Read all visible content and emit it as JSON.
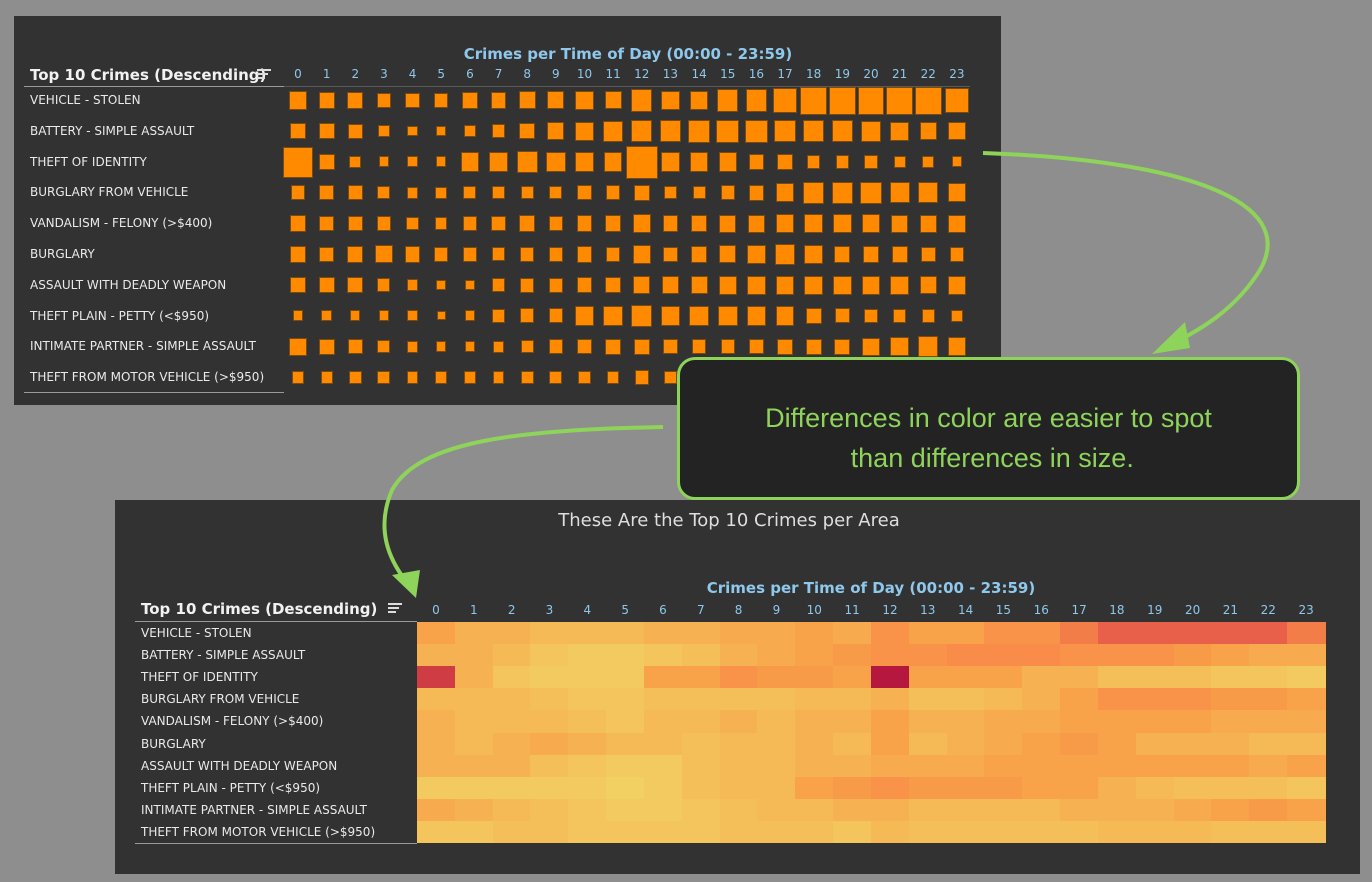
{
  "callout": {
    "line1": "Differences in color are easier to spot",
    "line2": " than differences in size."
  },
  "chart_data": [
    {
      "type": "scatter",
      "mark": "square-size",
      "title": "Crimes per Time of Day (00:00 - 23:59)",
      "row_header": "Top 10 Crimes (Descending)",
      "color": "#ff8a00",
      "hours": [
        "0",
        "1",
        "2",
        "3",
        "4",
        "5",
        "6",
        "7",
        "8",
        "9",
        "10",
        "11",
        "12",
        "13",
        "14",
        "15",
        "16",
        "17",
        "18",
        "19",
        "20",
        "21",
        "22",
        "23"
      ],
      "crimes": [
        "VEHICLE - STOLEN",
        "BATTERY - SIMPLE ASSAULT",
        "THEFT OF IDENTITY",
        "BURGLARY FROM VEHICLE",
        "VANDALISM - FELONY (>$400)",
        "BURGLARY",
        "ASSAULT WITH DEADLY WEAPON",
        "THEFT PLAIN - PETTY (<$950)",
        "INTIMATE PARTNER - SIMPLE ASSAULT",
        "THEFT FROM MOTOR VEHICLE (>$950)"
      ],
      "values_note": "relative crime count index 0-10 (estimated)",
      "values": [
        [
          5,
          4,
          4,
          3.5,
          3.5,
          3.5,
          4,
          4,
          4.5,
          4.5,
          5,
          4.5,
          6,
          5,
          5,
          6,
          6,
          7,
          8,
          8,
          8,
          8,
          8,
          7
        ],
        [
          4,
          4,
          3.5,
          2.5,
          2,
          2,
          2.5,
          3,
          4,
          4.5,
          5,
          5.5,
          6,
          6,
          6.5,
          6.5,
          6.5,
          6,
          6,
          6,
          5.5,
          5,
          4.5,
          4.5
        ],
        [
          9,
          4,
          2.5,
          2,
          2,
          2,
          5,
          5,
          6,
          5.5,
          5.5,
          5,
          10,
          5,
          5,
          5,
          4,
          4,
          3,
          3,
          3,
          2.5,
          2.5,
          2
        ],
        [
          3.5,
          3.5,
          3.5,
          3,
          2.5,
          2.5,
          3,
          3,
          3,
          3,
          3.5,
          3.5,
          4,
          3,
          3,
          3.5,
          4,
          5,
          6,
          6,
          6,
          5.5,
          5.5,
          5
        ],
        [
          4,
          3.5,
          3.5,
          3.5,
          3,
          2.5,
          3.5,
          3.5,
          4,
          3.5,
          4,
          4,
          5,
          4,
          4,
          4.5,
          4.5,
          5,
          5,
          5,
          5,
          4.5,
          4.5,
          4.5
        ],
        [
          4,
          3.5,
          4,
          4.5,
          4,
          3.5,
          3.5,
          3,
          3.5,
          3.5,
          4,
          3.5,
          5,
          3.5,
          4,
          4.5,
          5,
          5.5,
          5,
          4,
          4,
          4,
          3.5,
          3.5
        ],
        [
          4,
          4,
          4,
          3,
          2.5,
          2,
          2,
          3,
          3.5,
          3.5,
          4,
          4,
          4.5,
          4.5,
          4.5,
          5,
          5,
          5,
          5,
          5,
          5,
          5,
          4.5,
          5
        ],
        [
          2,
          2,
          2,
          2,
          2,
          1.5,
          2,
          3,
          3.5,
          3.5,
          5,
          5.5,
          6,
          5.5,
          5.5,
          5.5,
          5,
          5,
          4,
          3.5,
          3,
          3,
          3,
          2.5
        ],
        [
          4.5,
          4,
          3.5,
          3,
          2.5,
          2,
          2,
          2.5,
          3,
          3.5,
          3.5,
          4,
          4,
          3.5,
          3.5,
          3.5,
          3.5,
          4,
          4,
          4,
          4.5,
          5,
          5.5,
          5
        ],
        [
          2.5,
          2.5,
          3,
          3,
          2.5,
          2.5,
          2.5,
          2.5,
          3,
          3,
          3,
          2.5,
          3.5,
          3,
          3,
          3,
          3,
          3,
          3.5,
          3.5,
          3.5,
          3,
          3,
          3
        ]
      ]
    },
    {
      "type": "heatmap",
      "page_title": "These Are the Top 10 Crimes per Area",
      "title": "Crimes per Time of Day (00:00 - 23:59)",
      "row_header": "Top 10 Crimes (Descending)",
      "color_scale": [
        "#f2d062",
        "#f5b956",
        "#f8a24a",
        "#f98c48",
        "#e8604a",
        "#b5173e"
      ],
      "note": "same data as the square chart, encoded by color"
    }
  ]
}
